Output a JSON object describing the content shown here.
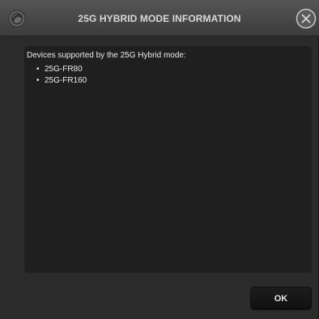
{
  "dialog": {
    "title": "25G HYBRID MODE INFORMATION",
    "logo_icon": "app-logo-icon",
    "close_icon": "close-icon"
  },
  "content": {
    "intro": "Devices supported by the 25G Hybrid mode:",
    "bullet": "•",
    "devices": [
      "25G-FR80",
      "25G-FR160"
    ]
  },
  "buttons": {
    "ok_label": "OK"
  },
  "colors": {
    "title_bar": "#4a4a4a",
    "background": "#2b2b2b",
    "panel": "#1f1f1f",
    "text": "#ececec"
  }
}
